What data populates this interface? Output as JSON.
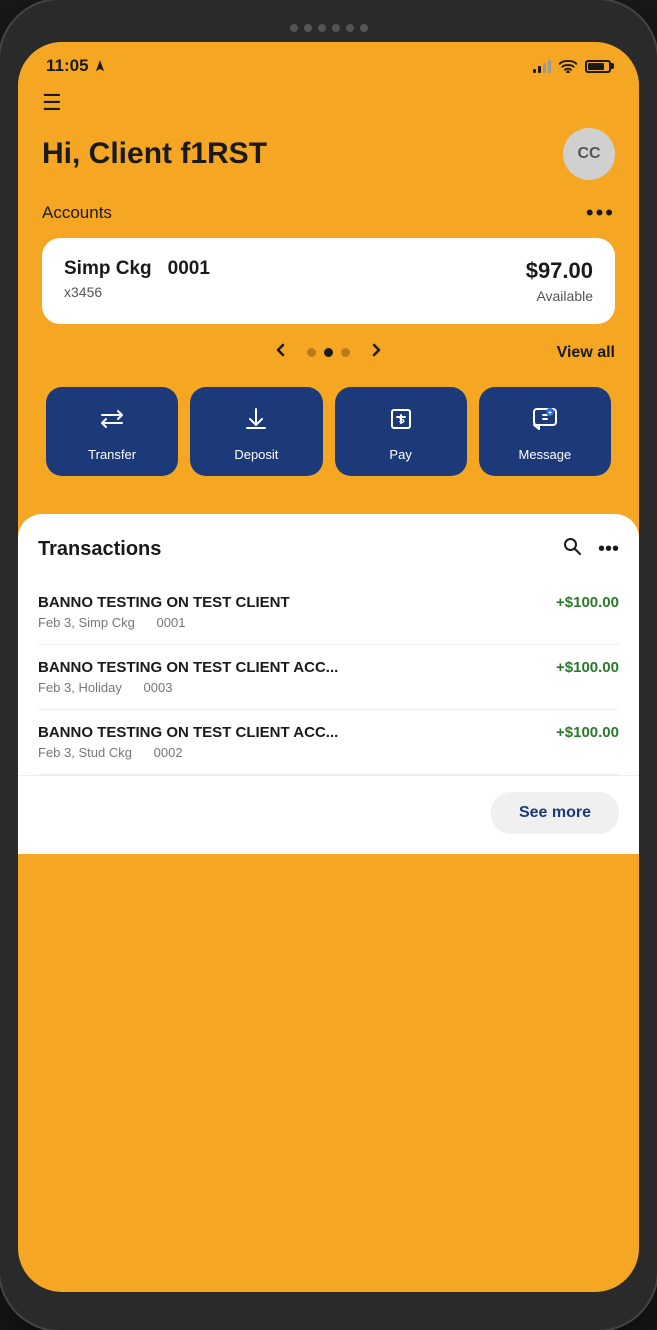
{
  "phone": {
    "notch_dots": 6
  },
  "status_bar": {
    "time": "11:05",
    "signal_bars": [
      4,
      6,
      8,
      10,
      12
    ],
    "battery_level": 80
  },
  "header": {
    "menu_icon": "☰",
    "greeting": "Hi, Client f1RST",
    "avatar_initials": "CC"
  },
  "accounts": {
    "label": "Accounts",
    "more_label": "•••",
    "card": {
      "name": "Simp Ckg",
      "number": "0001",
      "sub": "x3456",
      "balance": "$97.00",
      "available_label": "Available"
    },
    "carousel_dots": [
      "inactive",
      "active",
      "inactive"
    ],
    "view_all_label": "View all"
  },
  "actions": [
    {
      "id": "transfer",
      "label": "Transfer",
      "icon": "transfer"
    },
    {
      "id": "deposit",
      "label": "Deposit",
      "icon": "deposit"
    },
    {
      "id": "pay",
      "label": "Pay",
      "icon": "pay"
    },
    {
      "id": "message",
      "label": "Message",
      "icon": "message"
    }
  ],
  "transactions": {
    "title": "Transactions",
    "items": [
      {
        "name": "BANNO TESTING ON TEST CLIENT",
        "sub": "Feb 3, Simp Ckg",
        "account": "0001",
        "amount": "+$100.00"
      },
      {
        "name": "BANNO TESTING ON TEST CLIENT ACC...",
        "sub": "Feb 3, Holiday",
        "account": "0003",
        "amount": "+$100.00"
      },
      {
        "name": "BANNO TESTING ON TEST CLIENT ACC...",
        "sub": "Feb 3, Stud Ckg",
        "account": "0002",
        "amount": "+$100.00"
      }
    ],
    "see_more_label": "See more"
  },
  "colors": {
    "primary_yellow": "#f5a623",
    "primary_blue": "#1c3a7a",
    "positive_green": "#2a7a2a",
    "text_dark": "#1a1a1a"
  }
}
